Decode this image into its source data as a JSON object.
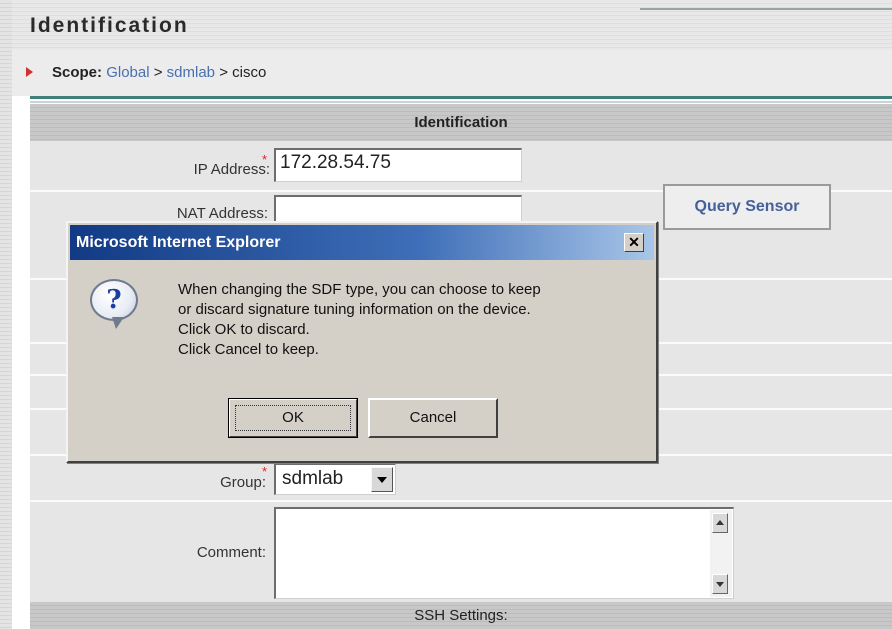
{
  "page": {
    "title": "Identification"
  },
  "scope": {
    "label": "Scope:",
    "crumbs": [
      "Global",
      "sdmlab",
      "cisco"
    ],
    "separator": ">"
  },
  "form": {
    "section_title": "Identification",
    "ip_label": "IP Address:",
    "ip_value": "172.28.54.75",
    "nat_label": "NAT Address:",
    "nat_value": "",
    "query_button": "Query Sensor",
    "group_label": "Group:",
    "group_value": "sdmlab",
    "comment_label": "Comment:",
    "comment_value": "",
    "ssh_section": "SSH Settings:"
  },
  "dialog": {
    "title": "Microsoft Internet Explorer",
    "close_glyph": "✕",
    "icon_glyph": "?",
    "message_lines": [
      "When changing the SDF type, you can choose to keep",
      "or discard signature tuning information on the device.",
      "Click OK to discard.",
      "Click Cancel to keep."
    ],
    "ok_label": "OK",
    "cancel_label": "Cancel"
  },
  "colors": {
    "title_bar_start": "#123a85",
    "title_bar_end": "#a9c6e8",
    "link": "#4a6fb0",
    "required": "#e02020",
    "query_text": "#46609a"
  }
}
